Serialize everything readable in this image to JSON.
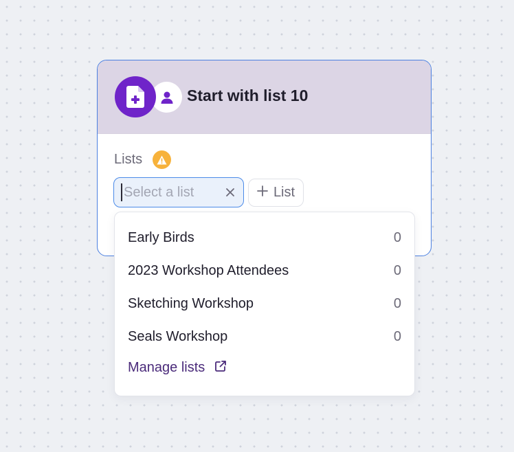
{
  "node": {
    "title": "Start with list 10",
    "icons": {
      "main": "add-document-icon",
      "secondary": "user-icon"
    },
    "colors": {
      "header_bg": "#dcd5e5",
      "accent": "#6f24c9",
      "border": "#4a7fe0",
      "warning": "#f7b23b"
    }
  },
  "lists_section": {
    "label": "Lists",
    "warning_icon": "warning-icon",
    "select": {
      "placeholder": "Select a list",
      "value": ""
    },
    "add_button_label": "List"
  },
  "dropdown": {
    "items": [
      {
        "name": "Early Birds",
        "count": "0"
      },
      {
        "name": "2023 Workshop Attendees",
        "count": "0"
      },
      {
        "name": "Sketching Workshop",
        "count": "0"
      },
      {
        "name": "Seals Workshop",
        "count": "0"
      }
    ],
    "manage_label": "Manage lists",
    "manage_icon": "external-link-icon"
  }
}
